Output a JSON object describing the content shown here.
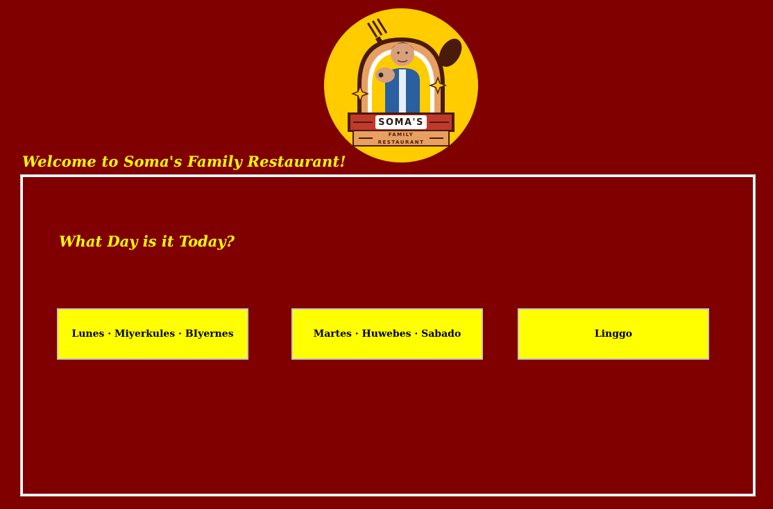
{
  "logo": {
    "brand_name": "SOMA'S",
    "line1": "FAMILY",
    "line2": "RESTAURANT",
    "colors": {
      "circle": "#ffcc00",
      "arch": "#e8a060",
      "banner": "#c0392b",
      "dark": "#4a1a0a"
    }
  },
  "header": {
    "welcome": "Welcome to Soma's Family Restaurant!"
  },
  "main": {
    "question": "What Day is it Today?",
    "buttons": [
      {
        "label": "Lunes · Miyerkules · BIyernes"
      },
      {
        "label": "Martes · Huwebes · Sabado"
      },
      {
        "label": "Linggo"
      }
    ]
  },
  "colors": {
    "background": "#800000",
    "accent": "#ffff00",
    "button_text": "#000000",
    "panel_border": "#ffffff"
  }
}
